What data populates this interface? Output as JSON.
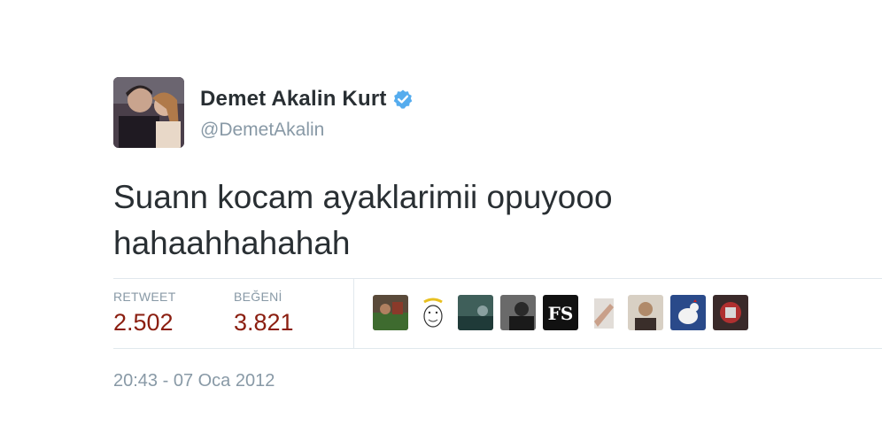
{
  "tweet": {
    "author": {
      "name": "Demet Akalin Kurt",
      "handle": "@DemetAkalin",
      "verified": true
    },
    "text_line1": "Suann kocam ayaklarimii opuyooo",
    "text_line2": "hahaahhahahah",
    "stats": {
      "retweet_label": "RETWEET",
      "retweet_count": "2.502",
      "like_label": "BEĞENİ",
      "like_count": "3.821"
    },
    "likers": [
      {
        "icon": "liker-avatar-photo"
      },
      {
        "icon": "liker-avatar-cartoon"
      },
      {
        "icon": "liker-avatar-photo"
      },
      {
        "icon": "liker-avatar-photo"
      },
      {
        "icon": "liker-avatar-fs-logo"
      },
      {
        "icon": "liker-avatar-photo"
      },
      {
        "icon": "liker-avatar-photo"
      },
      {
        "icon": "liker-avatar-rooster"
      },
      {
        "icon": "liker-avatar-photo"
      }
    ],
    "timestamp": "20:43 - 07 Oca 2012"
  },
  "colors": {
    "text": "#292f33",
    "muted": "#8899a6",
    "count": "#8b1e10",
    "verified": "#55acee",
    "border": "#e1e8ed"
  }
}
